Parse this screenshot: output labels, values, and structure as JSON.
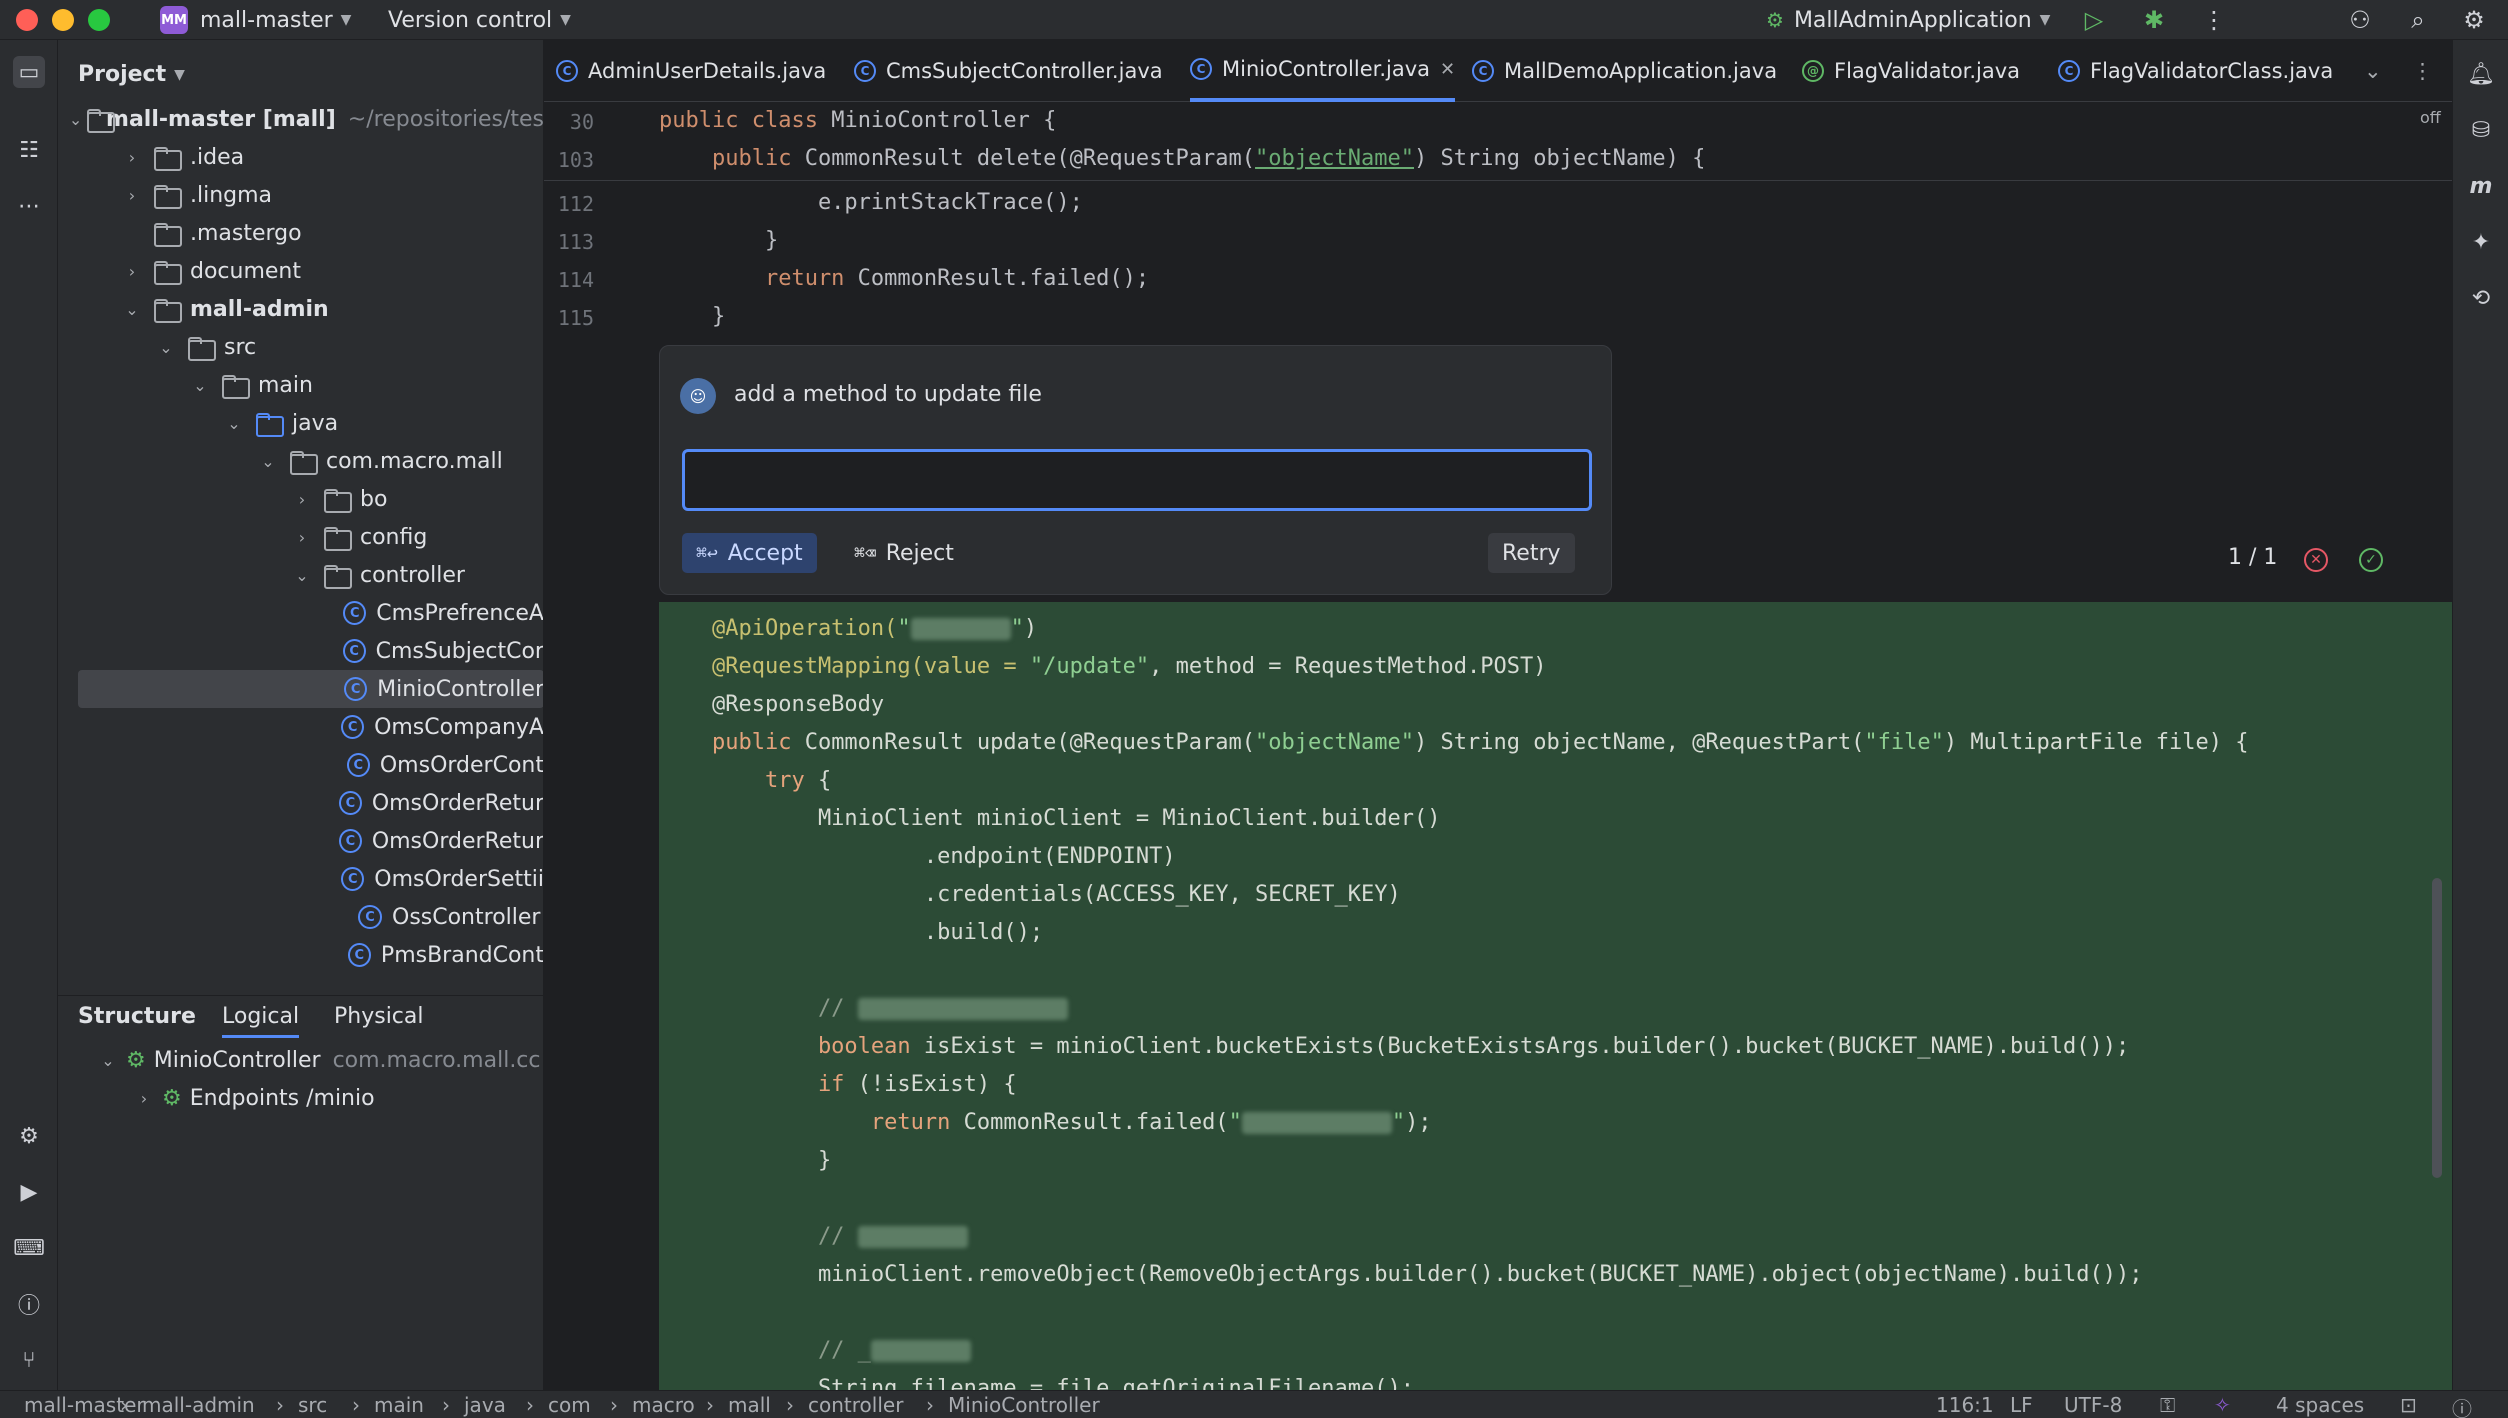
{
  "titlebar": {
    "project_badge": "MM",
    "project_name": "mall-master",
    "vcs": "Version control",
    "run_config": "MallAdminApplication"
  },
  "project_panel": {
    "title": "Project",
    "tree": [
      {
        "label": "mall-master [mall]",
        "muted": "~/repositories/tes",
        "kind": "module",
        "depth": 0,
        "expand": "open",
        "bold": true
      },
      {
        "label": ".idea",
        "kind": "folder",
        "depth": 1,
        "expand": "closed"
      },
      {
        "label": ".lingma",
        "kind": "folder",
        "depth": 1,
        "expand": "closed"
      },
      {
        "label": ".mastergo",
        "kind": "folder",
        "depth": 1,
        "expand": "none"
      },
      {
        "label": "document",
        "kind": "folder",
        "depth": 1,
        "expand": "closed"
      },
      {
        "label": "mall-admin",
        "kind": "module",
        "depth": 1,
        "expand": "open",
        "bold": true
      },
      {
        "label": "src",
        "kind": "folder",
        "depth": 2,
        "expand": "open"
      },
      {
        "label": "main",
        "kind": "folder",
        "depth": 3,
        "expand": "open"
      },
      {
        "label": "java",
        "kind": "folder-blue",
        "depth": 4,
        "expand": "open"
      },
      {
        "label": "com.macro.mall",
        "kind": "package",
        "depth": 5,
        "expand": "open"
      },
      {
        "label": "bo",
        "kind": "package",
        "depth": 6,
        "expand": "closed"
      },
      {
        "label": "config",
        "kind": "package",
        "depth": 6,
        "expand": "closed"
      },
      {
        "label": "controller",
        "kind": "package",
        "depth": 6,
        "expand": "open"
      },
      {
        "label": "CmsPrefrenceA",
        "kind": "class",
        "depth": 7,
        "expand": "none"
      },
      {
        "label": "CmsSubjectCor",
        "kind": "class",
        "depth": 7,
        "expand": "none"
      },
      {
        "label": "MinioController",
        "kind": "class",
        "depth": 7,
        "expand": "none",
        "selected": true
      },
      {
        "label": "OmsCompanyA",
        "kind": "class",
        "depth": 7,
        "expand": "none"
      },
      {
        "label": "OmsOrderCont",
        "kind": "class",
        "depth": 7,
        "expand": "none"
      },
      {
        "label": "OmsOrderRetur",
        "kind": "class",
        "depth": 7,
        "expand": "none"
      },
      {
        "label": "OmsOrderRetur",
        "kind": "class",
        "depth": 7,
        "expand": "none"
      },
      {
        "label": "OmsOrderSettii",
        "kind": "class",
        "depth": 7,
        "expand": "none"
      },
      {
        "label": "OssController",
        "kind": "class",
        "depth": 7,
        "expand": "none"
      },
      {
        "label": "PmsBrandCont",
        "kind": "class",
        "depth": 7,
        "expand": "none"
      }
    ]
  },
  "structure": {
    "title": "Structure",
    "tabs": [
      "Logical",
      "Physical"
    ],
    "active_tab": "Logical",
    "items": [
      {
        "label": "MinioController",
        "muted": "com.macro.mall.cc"
      },
      {
        "label": "Endpoints /minio",
        "muted": ""
      }
    ]
  },
  "editor": {
    "tabs": [
      {
        "label": "AdminUserDetails.java"
      },
      {
        "label": "CmsSubjectController.java"
      },
      {
        "label": "MinioController.java",
        "active": true
      },
      {
        "label": "MallDemoApplication.java"
      },
      {
        "label": "FlagValidator.java"
      },
      {
        "label": "FlagValidatorClass.java"
      }
    ],
    "off_label": "off",
    "line_numbers": [
      "30",
      "103",
      "112",
      "113",
      "114",
      "115"
    ],
    "sticky_1": "public class MinioController {",
    "sticky_2a": "    public CommonResult delete(@RequestParam(",
    "sticky_2s": "\"objectName\"",
    "sticky_2b": ") String objectName) {",
    "l112": "            e.printStackTrace();",
    "l113": "        }",
    "l114kw": "        return",
    "l114": " CommonResult.failed();",
    "l115": "    }",
    "diff": {
      "d1a": "    @ApiOperation(",
      "d1q": "\"",
      "d1b": ")",
      "d2a": "    @RequestMapping(value = ",
      "d2s": "\"/update\"",
      "d2b": ", method = RequestMethod.POST)",
      "d3": "    @ResponseBody",
      "d4kw": "    public",
      "d4a": " CommonResult update(@RequestParam(",
      "d4s": "\"objectName\"",
      "d4b": ") String objectName, @RequestPart(",
      "d4s2": "\"file\"",
      "d4c": ") MultipartFile file) {",
      "d5kw": "        try",
      "d5": " {",
      "d6": "            MinioClient minioClient = MinioClient.builder()",
      "d7": "                    .endpoint(ENDPOINT)",
      "d8": "                    .credentials(ACCESS_KEY, SECRET_KEY)",
      "d9": "                    .build();",
      "d10": "            // ",
      "d11kw": "            boolean",
      "d11": " isExist = minioClient.bucketExists(BucketExistsArgs.builder().bucket(BUCKET_NAME).build());",
      "d12kw": "            if",
      "d12": " (!isExist) {",
      "d13kw": "                return",
      "d13a": " CommonResult.failed(",
      "d13b": ");",
      "d14": "            }",
      "d15": "            // ",
      "d16": "            minioClient.removeObject(RemoveObjectArgs.builder().bucket(BUCKET_NAME).object(objectName).build());",
      "d17": "            // _",
      "d18": "            String filename = file.getOriginalFilename();"
    }
  },
  "ai_popup": {
    "prompt": "add a method to update file",
    "input_value": "",
    "accept_kbd": "⌘↩",
    "accept_label": "Accept",
    "reject_kbd": "⌘⌫",
    "reject_label": "Reject",
    "retry_label": "Retry",
    "counter": "1 / 1"
  },
  "statusbar": {
    "breadcrumbs": [
      "mall-master",
      "mall-admin",
      "src",
      "main",
      "java",
      "com",
      "macro",
      "mall",
      "controller",
      "MinioController"
    ],
    "position": "116:1",
    "line_sep": "LF",
    "encoding": "UTF-8",
    "indent": "4 spaces"
  },
  "colors": {
    "accent": "#548af7",
    "diff_bg": "#2c4b36",
    "close_red": "#e55765",
    "ok_green": "#5fb865"
  }
}
